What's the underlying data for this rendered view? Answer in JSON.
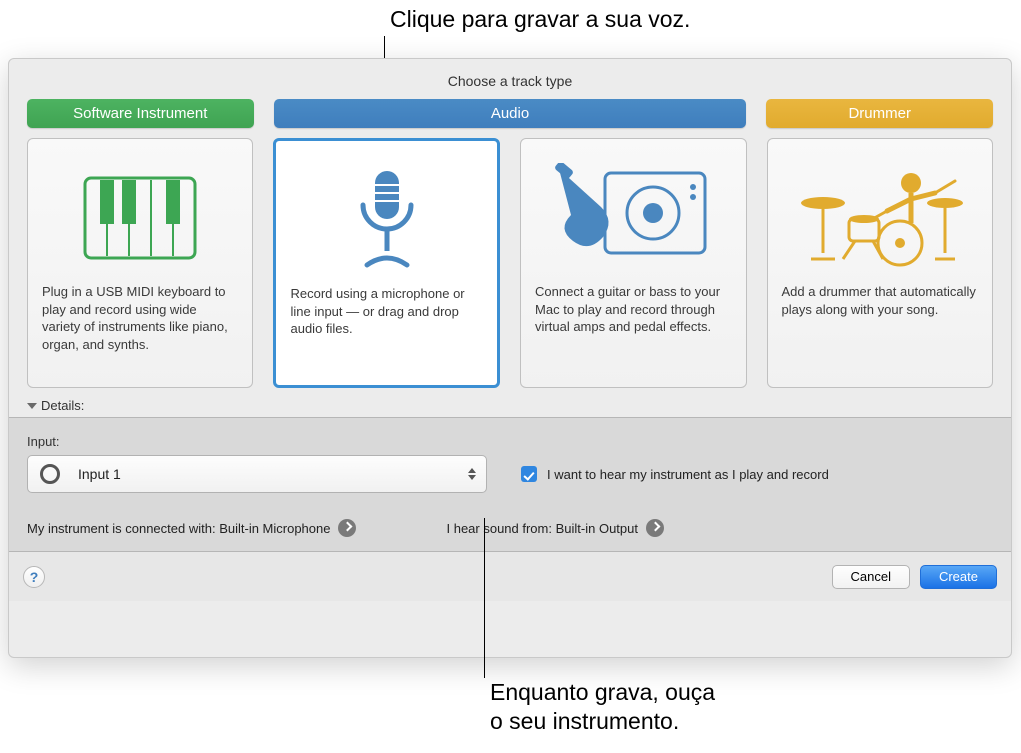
{
  "callouts": {
    "top": "Clique para gravar a sua voz.",
    "bottom_line1": "Enquanto grava, ouça",
    "bottom_line2": "o seu instrumento."
  },
  "window": {
    "title": "Choose a track type",
    "tabs": {
      "software": "Software Instrument",
      "audio": "Audio",
      "drummer": "Drummer"
    },
    "cards": {
      "software": "Plug in a USB MIDI keyboard to play and record using wide variety of instruments like piano, organ, and synths.",
      "mic": "Record using a microphone or line input — or drag and drop audio files.",
      "guitar": "Connect a guitar or bass to your Mac to play and record through virtual amps and pedal effects.",
      "drummer": "Add a drummer that automatically plays along with your song."
    },
    "details_label": "Details:",
    "input_label": "Input:",
    "input_value": "Input 1",
    "monitor_label": "I want to hear my instrument as I play and record",
    "connected_prefix": "My instrument is connected with: ",
    "connected_value": "Built-in Microphone",
    "hear_prefix": "I hear sound from: ",
    "hear_value": "Built-in Output",
    "help": "?",
    "cancel": "Cancel",
    "create": "Create"
  }
}
